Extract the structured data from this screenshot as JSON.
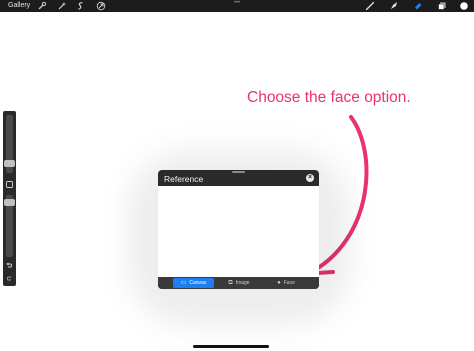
{
  "toolbar": {
    "gallery_label": "Gallery",
    "left_icons": [
      "wrench-icon",
      "magic-wand-icon",
      "selection-icon",
      "transform-arrow-icon"
    ],
    "right_icons": [
      "brush-icon",
      "smudge-icon",
      "eraser-icon",
      "layers-icon",
      "color-swatch-icon"
    ],
    "accent_color": "#1e7ef0"
  },
  "annotation": {
    "text": "Choose the face option.",
    "color": "#e8336d"
  },
  "reference_panel": {
    "title": "Reference",
    "tabs": [
      {
        "label": "Canvas",
        "icon": "canvas-icon",
        "active": true
      },
      {
        "label": "Image",
        "icon": "image-icon",
        "active": false
      },
      {
        "label": "Face",
        "icon": "face-icon",
        "active": false
      }
    ]
  },
  "sidebar": {
    "icons": [
      "square-modify-icon",
      "undo-icon"
    ]
  }
}
